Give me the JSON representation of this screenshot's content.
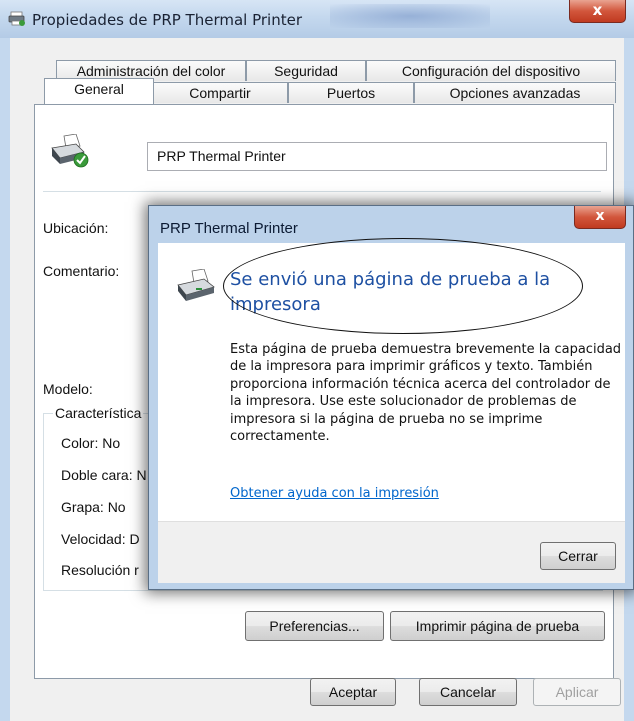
{
  "window": {
    "title": "Propiedades de PRP Thermal Printer",
    "close_glyph": "x"
  },
  "tabs": {
    "row1": [
      "Administración del color",
      "Seguridad",
      "Configuración del dispositivo"
    ],
    "row2": [
      "General",
      "Compartir",
      "Puertos",
      "Opciones avanzadas"
    ],
    "active": "General"
  },
  "general": {
    "printer_name": "PRP Thermal Printer",
    "location_label": "Ubicación:",
    "comment_label": "Comentario:",
    "model_label": "Modelo:",
    "features_label": "Característica",
    "features": [
      "Color: No",
      "Doble cara: N",
      "Grapa: No",
      "Velocidad: D",
      "Resolución r"
    ]
  },
  "buttons": {
    "preferences": "Preferencias...",
    "print_test": "Imprimir página de prueba",
    "ok": "Aceptar",
    "cancel": "Cancelar",
    "apply": "Aplicar"
  },
  "dialog": {
    "title": "PRP Thermal Printer",
    "close_glyph": "x",
    "heading": "Se envió una página de prueba a la impresora",
    "body": "Esta página de prueba demuestra brevemente la capacidad de la impresora para imprimir gráficos y texto. También proporciona información técnica acerca del controlador de la impresora.  Use este solucionador de problemas de impresora si la página de prueba no se imprime correctamente.",
    "help_link": "Obtener ayuda con la impresión",
    "close_button": "Cerrar"
  }
}
